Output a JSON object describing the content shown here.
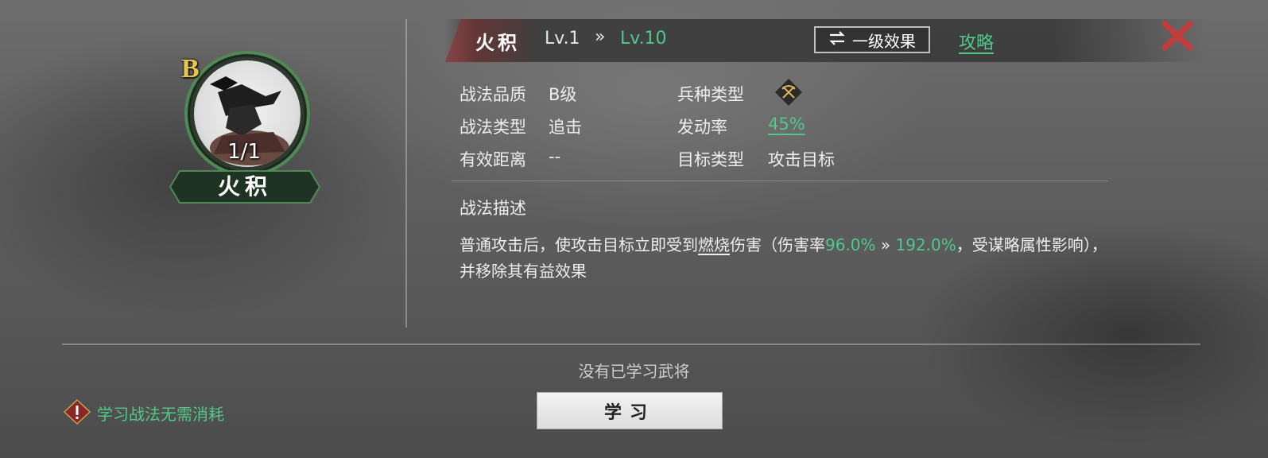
{
  "portrait": {
    "grade": "B",
    "count": "1/1",
    "name": "火积",
    "ring_color": "#4f8a55"
  },
  "header": {
    "skill_name": "火积",
    "level_current": "Lv.1",
    "level_arrow": "»",
    "level_max": "Lv.10",
    "effect_toggle_icon": "swap-arrows-icon",
    "effect_toggle_label": "一级效果",
    "guide_label": "攻略",
    "close_icon": "close-icon"
  },
  "info": {
    "quality_label": "战法品质",
    "quality_value": "B级",
    "type_label": "战法类型",
    "type_value": "追击",
    "range_label": "有效距离",
    "range_value": "--",
    "troop_label": "兵种类型",
    "troop_icon": "crossbow-icon",
    "rate_label": "发动率",
    "rate_value": "45%",
    "target_label": "目标类型",
    "target_value": "攻击目标"
  },
  "description": {
    "title": "战法描述",
    "part1": "普通攻击后，使攻击目标立即受到",
    "burn": "燃烧",
    "part2": "伤害（伤害率",
    "rate_min": "96.0%",
    "arrow": " » ",
    "rate_max": "192.0%",
    "part3": "，受谋略属性影响），并移除其有益效果"
  },
  "footer": {
    "no_general_text": "没有已学习武将",
    "learn_button": "学习",
    "warning_icon": "warning-icon",
    "free_note": "学习战法无需消耗"
  },
  "colors": {
    "accent_green": "#4fc98a",
    "grade_gold": "#e8c64a",
    "close_red": "#c83a3a"
  }
}
